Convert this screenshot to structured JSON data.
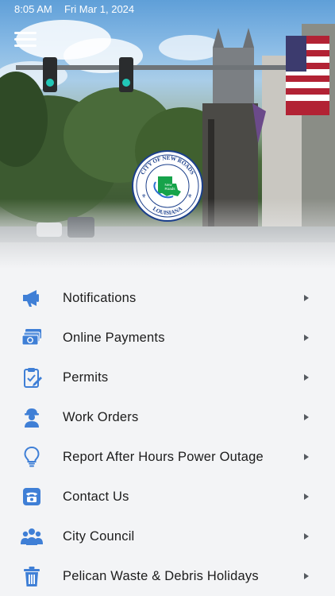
{
  "status_bar": {
    "time": "8:05 AM",
    "date": "Fri Mar 1, 2024"
  },
  "header": {
    "menu_icon": "hamburger-menu-icon",
    "seal": {
      "top_text": "CITY OF NEW ROADS",
      "bottom_text": "LOUISIANA",
      "side_text": "FALSE RIVER",
      "center_text_1": "New",
      "center_text_2": "Roads"
    }
  },
  "colors": {
    "icon": "#3f7fd6",
    "text": "#1c1c1c",
    "background": "#f3f4f6",
    "chevron": "#555a60"
  },
  "menu": [
    {
      "label": "Notifications",
      "icon": "megaphone-icon"
    },
    {
      "label": "Online Payments",
      "icon": "money-icon"
    },
    {
      "label": "Permits",
      "icon": "clipboard-icon"
    },
    {
      "label": "Work Orders",
      "icon": "worker-icon"
    },
    {
      "label": "Report After Hours Power Outage",
      "icon": "lightbulb-icon"
    },
    {
      "label": "Contact Us",
      "icon": "phone-icon"
    },
    {
      "label": "City Council",
      "icon": "users-icon"
    },
    {
      "label": "Pelican Waste & Debris Holidays",
      "icon": "trash-icon"
    }
  ]
}
